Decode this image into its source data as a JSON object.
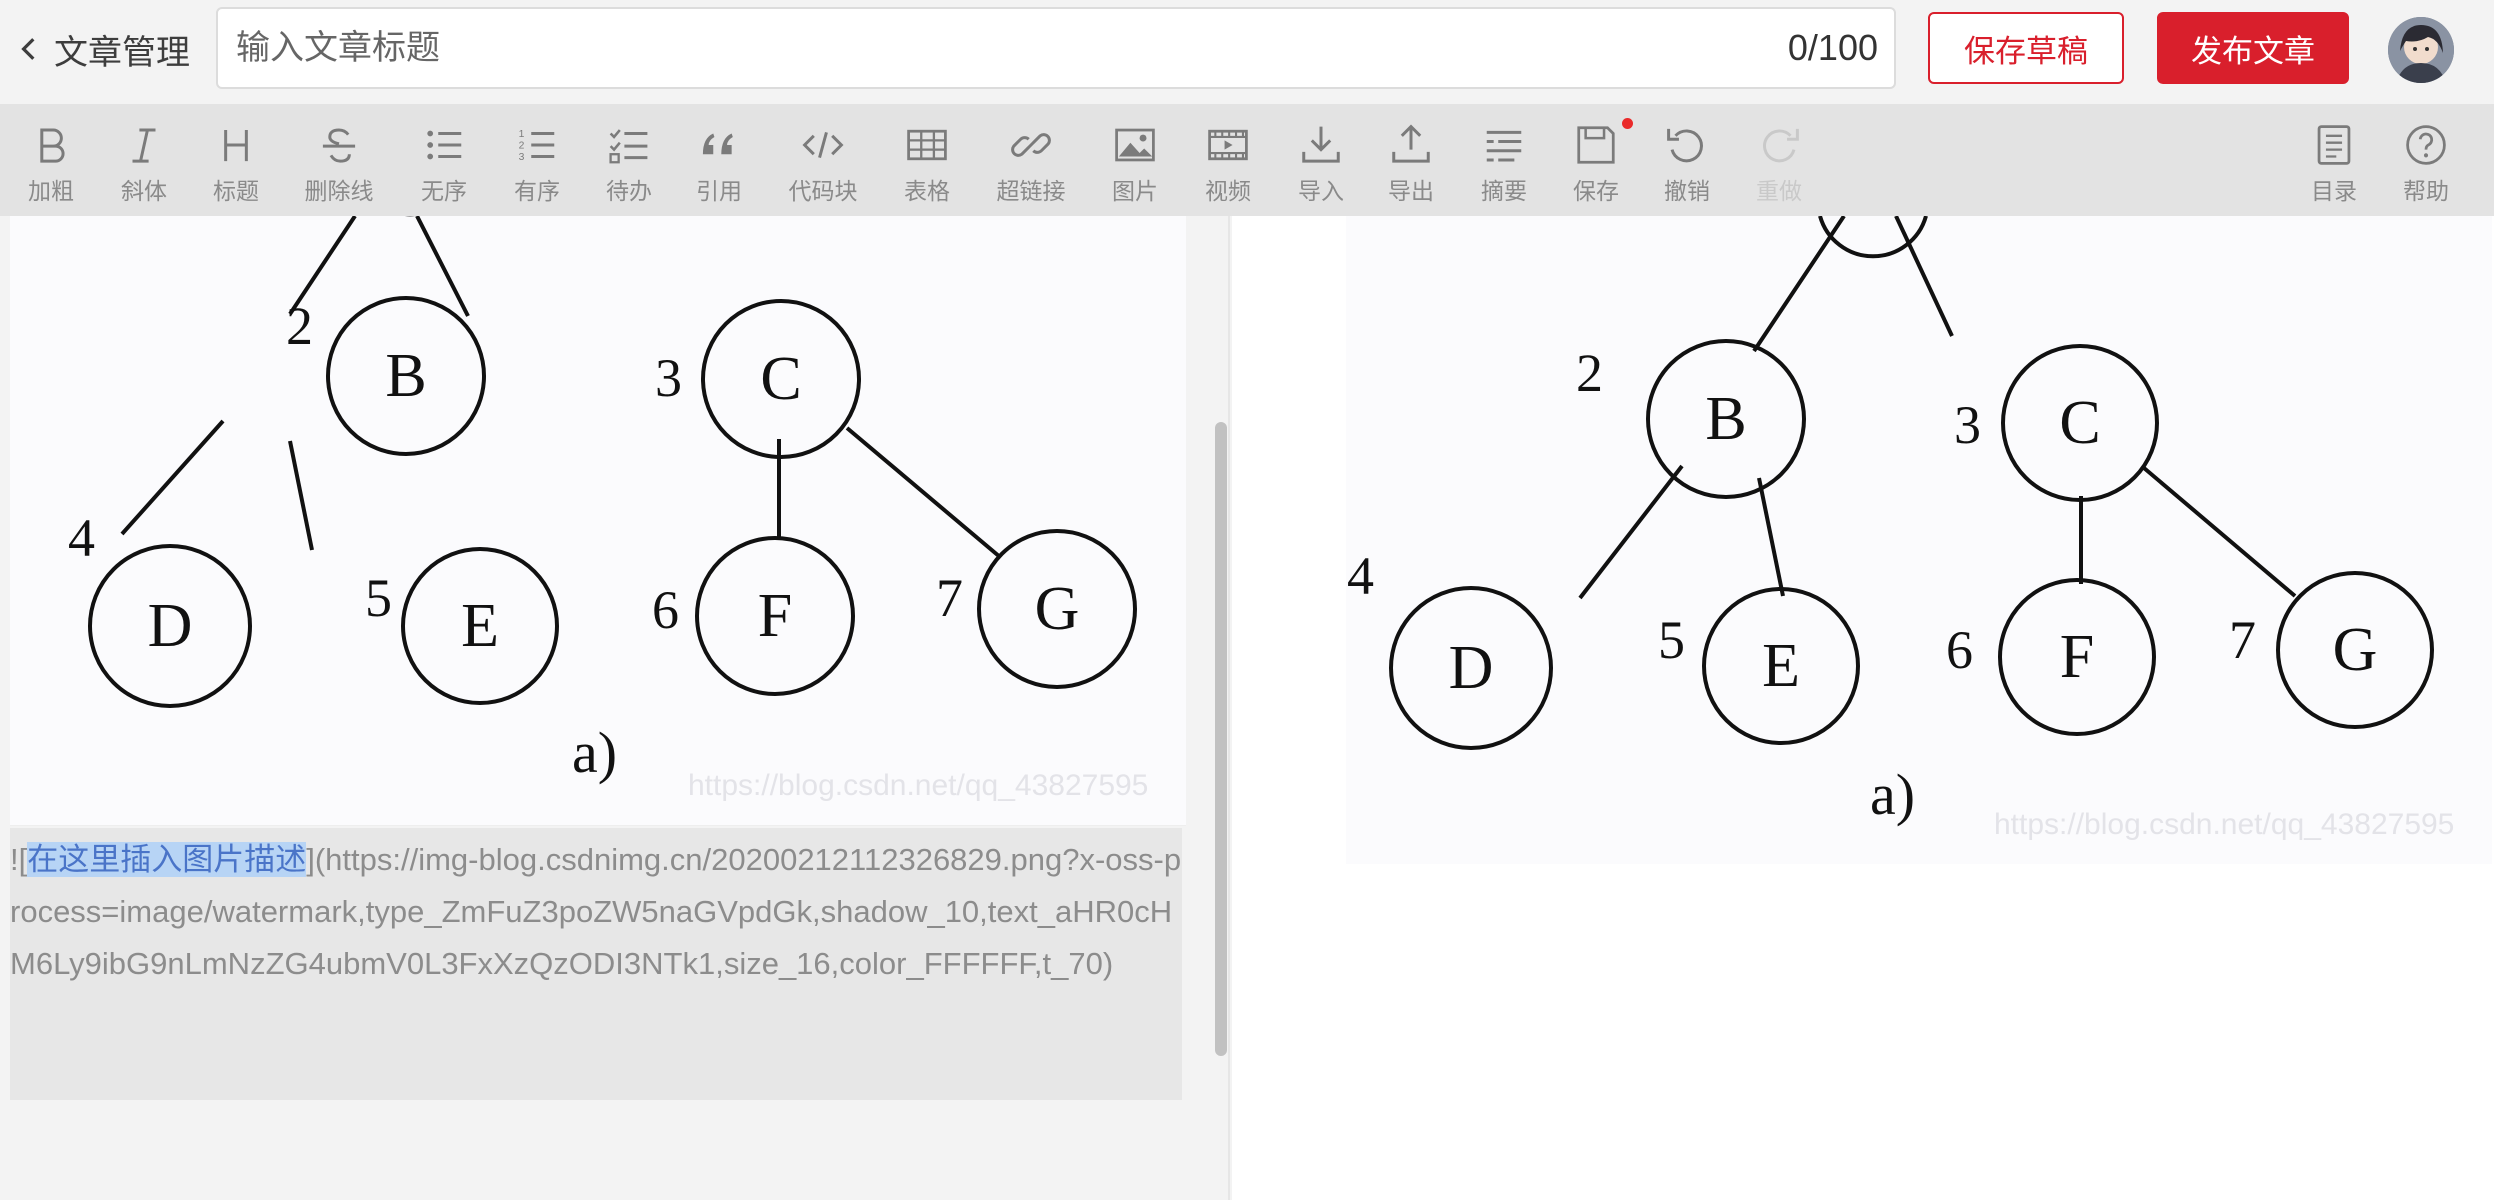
{
  "header": {
    "back_label": "文章管理",
    "title_placeholder": "输入文章标题",
    "title_value": "",
    "counter": "0/100",
    "save_draft_label": "保存草稿",
    "publish_label": "发布文章"
  },
  "toolbar": {
    "tools": [
      {
        "label": "加粗",
        "icon": "bold-icon"
      },
      {
        "label": "斜体",
        "icon": "italic-icon"
      },
      {
        "label": "标题",
        "icon": "heading-icon"
      },
      {
        "label": "删除线",
        "icon": "strikethrough-icon"
      },
      {
        "label": "无序",
        "icon": "unordered-list-icon"
      },
      {
        "label": "有序",
        "icon": "ordered-list-icon"
      },
      {
        "label": "待办",
        "icon": "todo-list-icon"
      },
      {
        "label": "引用",
        "icon": "quote-icon"
      },
      {
        "label": "代码块",
        "icon": "code-block-icon"
      },
      {
        "label": "表格",
        "icon": "table-icon"
      },
      {
        "label": "超链接",
        "icon": "link-icon"
      },
      {
        "label": "图片",
        "icon": "image-icon"
      },
      {
        "label": "视频",
        "icon": "video-icon"
      },
      {
        "label": "导入",
        "icon": "import-icon"
      },
      {
        "label": "导出",
        "icon": "export-icon"
      },
      {
        "label": "摘要",
        "icon": "summary-icon"
      },
      {
        "label": "保存",
        "icon": "save-icon"
      },
      {
        "label": "撤销",
        "icon": "undo-icon"
      },
      {
        "label": "重做",
        "icon": "redo-icon",
        "disabled": true
      }
    ],
    "right_tools": [
      {
        "label": "目录",
        "icon": "toc-icon"
      },
      {
        "label": "帮助",
        "icon": "help-icon"
      }
    ]
  },
  "editor": {
    "image_alt": "在这里插入图片描述",
    "prefix": "![",
    "suffix": "](https://img-blog.csdnimg.cn/20200212112326829.png?x-oss-process=image/watermark,type_ZmFuZ3poZW5naGVpdGk,shadow_10,text_aHR0cHM6Ly9ibG9nLmNzZG4ubmV0L3FxXzQzODI3NTk1,size_16,color_FFFFFF,t_70)",
    "watermark": "https://blog.csdn.net/qq_43827595"
  },
  "tree_figure": {
    "caption": "a)",
    "nodes": [
      {
        "letter": "B",
        "number": "2"
      },
      {
        "letter": "C",
        "number": "3"
      },
      {
        "letter": "D",
        "number": "4"
      },
      {
        "letter": "E",
        "number": "5"
      },
      {
        "letter": "F",
        "number": "6"
      },
      {
        "letter": "G",
        "number": "7"
      }
    ]
  },
  "preview": {
    "watermark": "https://blog.csdn.net/qq_43827595"
  },
  "colors": {
    "brand_red": "#d91f2c",
    "toolbar_bg": "#e3e3e3",
    "selection_highlight": "#b7d4f5"
  }
}
